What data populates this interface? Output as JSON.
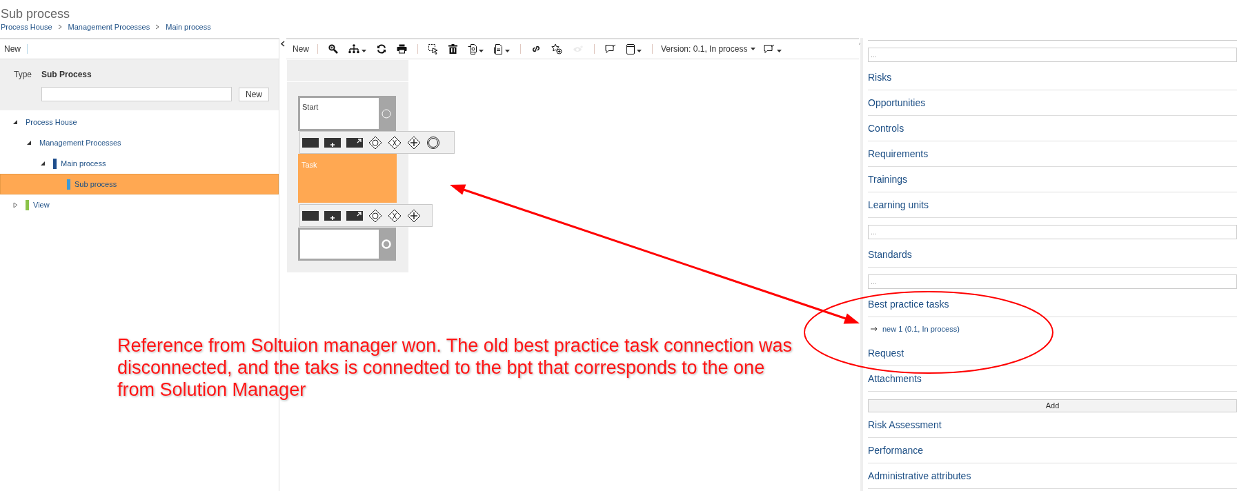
{
  "page": {
    "title": "Sub process",
    "breadcrumb": [
      "Process House",
      "Management Processes",
      "Main process"
    ]
  },
  "left_pane": {
    "toolbar_button": "New",
    "type_label": "Type",
    "type_value": "Sub Process",
    "new_button": "New",
    "tree": [
      {
        "label": "Process House",
        "expanded": true,
        "selected": false,
        "children": [
          {
            "label": "Management Processes",
            "expanded": true,
            "selected": false,
            "children": [
              {
                "label": "Main process",
                "expanded": true,
                "selected": false,
                "color": "#1f4e8c",
                "children": [
                  {
                    "label": "Sub process",
                    "selected": true,
                    "color": "#3c9ad8"
                  }
                ]
              }
            ]
          }
        ]
      },
      {
        "label": "View",
        "expanded": false,
        "selected": false,
        "color": "#8bc34a"
      }
    ]
  },
  "editor": {
    "toolbar": [
      {
        "kind": "button",
        "label": "New"
      },
      {
        "kind": "separator"
      },
      {
        "kind": "icon",
        "dropdown": false,
        "disabled": false
      },
      {
        "kind": "icon",
        "dropdown": true,
        "disabled": false
      },
      {
        "kind": "icon",
        "dropdown": false,
        "disabled": false
      },
      {
        "kind": "icon",
        "dropdown": false,
        "disabled": false
      },
      {
        "kind": "separator"
      },
      {
        "kind": "icon",
        "dropdown": false,
        "disabled": false
      },
      {
        "kind": "icon",
        "dropdown": false,
        "disabled": false
      },
      {
        "kind": "icon",
        "dropdown": true,
        "disabled": false
      },
      {
        "kind": "icon",
        "dropdown": true,
        "disabled": false
      },
      {
        "kind": "separator"
      },
      {
        "kind": "icon",
        "dropdown": false,
        "disabled": false
      },
      {
        "kind": "icon",
        "dropdown": false,
        "disabled": false
      },
      {
        "kind": "icon",
        "dropdown": false,
        "disabled": true
      },
      {
        "kind": "separator"
      },
      {
        "kind": "icon",
        "dropdown": false,
        "disabled": false
      },
      {
        "kind": "icon",
        "dropdown": true,
        "disabled": false
      },
      {
        "kind": "separator"
      },
      {
        "kind": "menu",
        "label": "Version: 0.1, In process",
        "dropdown": true
      },
      {
        "kind": "icon",
        "dropdown": true,
        "disabled": false
      }
    ],
    "diagram": {
      "shapes": [
        {
          "kind": "start",
          "label": "Start",
          "selected": false
        },
        {
          "kind": "task",
          "label": "Task",
          "selected": true
        },
        {
          "kind": "end",
          "selected": false
        }
      ]
    }
  },
  "right_pane": {
    "sections": [
      {
        "kind": "field",
        "value": "..."
      },
      {
        "kind": "heading",
        "label": "Risks"
      },
      {
        "kind": "heading",
        "label": "Opportunities"
      },
      {
        "kind": "heading",
        "label": "Controls"
      },
      {
        "kind": "heading",
        "label": "Requirements"
      },
      {
        "kind": "heading",
        "label": "Trainings"
      },
      {
        "kind": "heading",
        "label": "Learning units"
      },
      {
        "kind": "field",
        "value": "..."
      },
      {
        "kind": "heading",
        "label": "Standards"
      },
      {
        "kind": "field",
        "value": "..."
      },
      {
        "kind": "heading",
        "label": "Best practice tasks"
      },
      {
        "kind": "link",
        "label": "new 1 (0.1, In process)"
      },
      {
        "kind": "heading",
        "label": "Request"
      },
      {
        "kind": "heading",
        "label": "Attachments"
      },
      {
        "kind": "button",
        "label": "Add"
      },
      {
        "kind": "heading",
        "label": "Risk Assessment"
      },
      {
        "kind": "heading",
        "label": "Performance"
      },
      {
        "kind": "heading",
        "label": "Administrative attributes"
      }
    ]
  },
  "annotation": {
    "text": "Reference from Soltuion manager won. The old best practice task connection was\ndisconnected, and the taks is connedted to the bpt that corresponds to the one\nfrom Solution Manager"
  }
}
